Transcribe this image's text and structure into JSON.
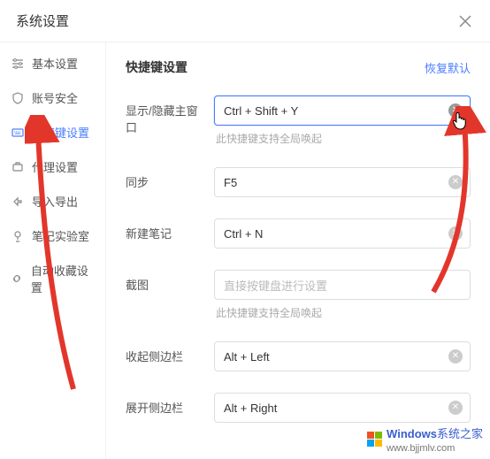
{
  "header": {
    "title": "系统设置"
  },
  "sidebar": {
    "items": [
      {
        "label": "基本设置",
        "icon": "sliders-icon"
      },
      {
        "label": "账号安全",
        "icon": "shield-icon"
      },
      {
        "label": "快捷键设置",
        "icon": "keyboard-icon",
        "active": true
      },
      {
        "label": "代理设置",
        "icon": "proxy-icon"
      },
      {
        "label": "导入导出",
        "icon": "import-export-icon"
      },
      {
        "label": "笔记实验室",
        "icon": "lab-icon"
      },
      {
        "label": "自动收藏设置",
        "icon": "link-icon"
      }
    ]
  },
  "section": {
    "title": "快捷键设置",
    "restore": "恢复默认"
  },
  "rows": [
    {
      "label": "显示/隐藏主窗口",
      "value": "Ctrl + Shift + Y",
      "hint": "此快捷键支持全局唤起",
      "focused": true,
      "clearable": true,
      "clearDark": true
    },
    {
      "label": "同步",
      "value": "F5",
      "clearable": true
    },
    {
      "label": "新建笔记",
      "value": "Ctrl + N",
      "clearable": true
    },
    {
      "label": "截图",
      "placeholder": "直接按键盘进行设置",
      "hint": "此快捷键支持全局唤起"
    },
    {
      "label": "收起侧边栏",
      "value": "Alt + Left",
      "clearable": true
    },
    {
      "label": "展开侧边栏",
      "value": "Alt + Right",
      "clearable": true
    }
  ],
  "watermark": {
    "brand": "Windows",
    "suffix": "系统之家",
    "domain": "www.bjjmlv.com"
  }
}
